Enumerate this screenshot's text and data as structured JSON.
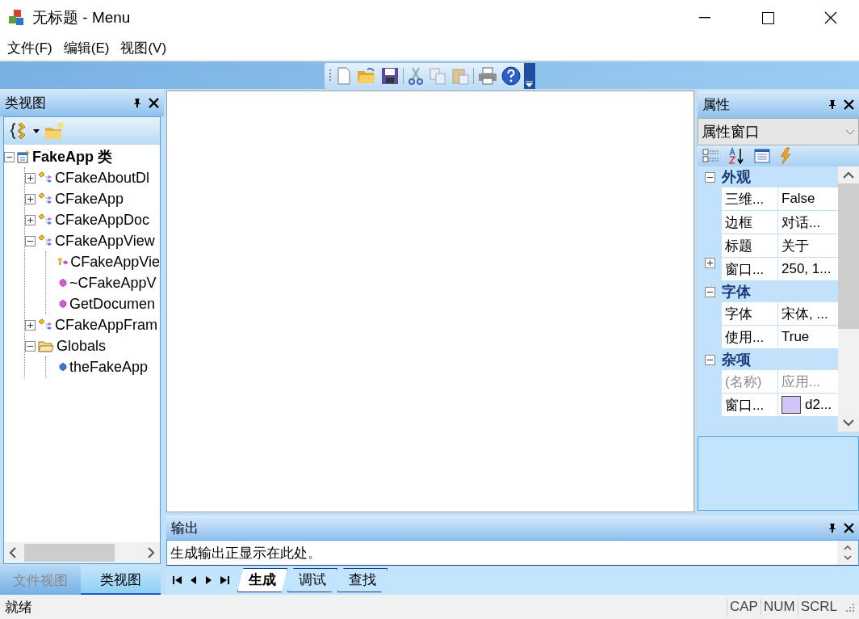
{
  "window": {
    "title": "无标题 - Menu"
  },
  "menu": [
    "文件(F)",
    "编辑(E)",
    "视图(V)"
  ],
  "class_view": {
    "title": "类视图",
    "tree": [
      {
        "label": "FakeApp 类",
        "kind": "project",
        "expanded": true,
        "children": [
          {
            "label": "CFakeAboutDl",
            "kind": "class",
            "expanded": false
          },
          {
            "label": "CFakeApp",
            "kind": "class",
            "expanded": false
          },
          {
            "label": "CFakeAppDoc",
            "kind": "class",
            "expanded": false
          },
          {
            "label": "CFakeAppView",
            "kind": "class",
            "expanded": true,
            "children": [
              {
                "label": "CFakeAppVie",
                "kind": "protected-method"
              },
              {
                "label": "~CFakeAppV",
                "kind": "method"
              },
              {
                "label": "GetDocumen",
                "kind": "method"
              }
            ]
          },
          {
            "label": "CFakeAppFram",
            "kind": "class",
            "expanded": false
          },
          {
            "label": "Globals",
            "kind": "folder",
            "expanded": true,
            "children": [
              {
                "label": "theFakeApp",
                "kind": "variable"
              }
            ]
          }
        ]
      }
    ],
    "tabs": [
      {
        "label": "文件视图",
        "selected": false
      },
      {
        "label": "类视图",
        "selected": true
      }
    ]
  },
  "properties": {
    "title": "属性",
    "combo": "属性窗口",
    "groups": [
      {
        "label": "外观",
        "expanded": true,
        "rows": [
          {
            "name": "三维...",
            "value": "False",
            "expanded": null,
            "disabled": false
          },
          {
            "name": "边框",
            "value": "对话...",
            "expanded": null,
            "disabled": false
          },
          {
            "name": "标题",
            "value": "关于",
            "expanded": null,
            "disabled": false
          },
          {
            "name": "窗口...",
            "value": "250, 1...",
            "expanded": false,
            "disabled": false
          }
        ]
      },
      {
        "label": "字体",
        "expanded": true,
        "rows": [
          {
            "name": "字体",
            "value": "宋体, ...",
            "expanded": null,
            "disabled": false
          },
          {
            "name": "使用...",
            "value": "True",
            "expanded": null,
            "disabled": false
          }
        ]
      },
      {
        "label": "杂项",
        "expanded": true,
        "rows": [
          {
            "name": "(名称)",
            "value": "应用...",
            "expanded": null,
            "disabled": true
          },
          {
            "name": "窗口...",
            "value": "d2...",
            "expanded": null,
            "disabled": false,
            "color": "#d2c4f7"
          }
        ]
      }
    ]
  },
  "output": {
    "title": "输出",
    "lines": [
      "生成输出正显示在此处。"
    ],
    "tabs": [
      {
        "label": "生成",
        "selected": true
      },
      {
        "label": "调试",
        "selected": false
      },
      {
        "label": "查找",
        "selected": false
      }
    ]
  },
  "status_bar": {
    "message": "就绪",
    "indicators": [
      "CAP",
      "NUM",
      "SCRL"
    ]
  }
}
